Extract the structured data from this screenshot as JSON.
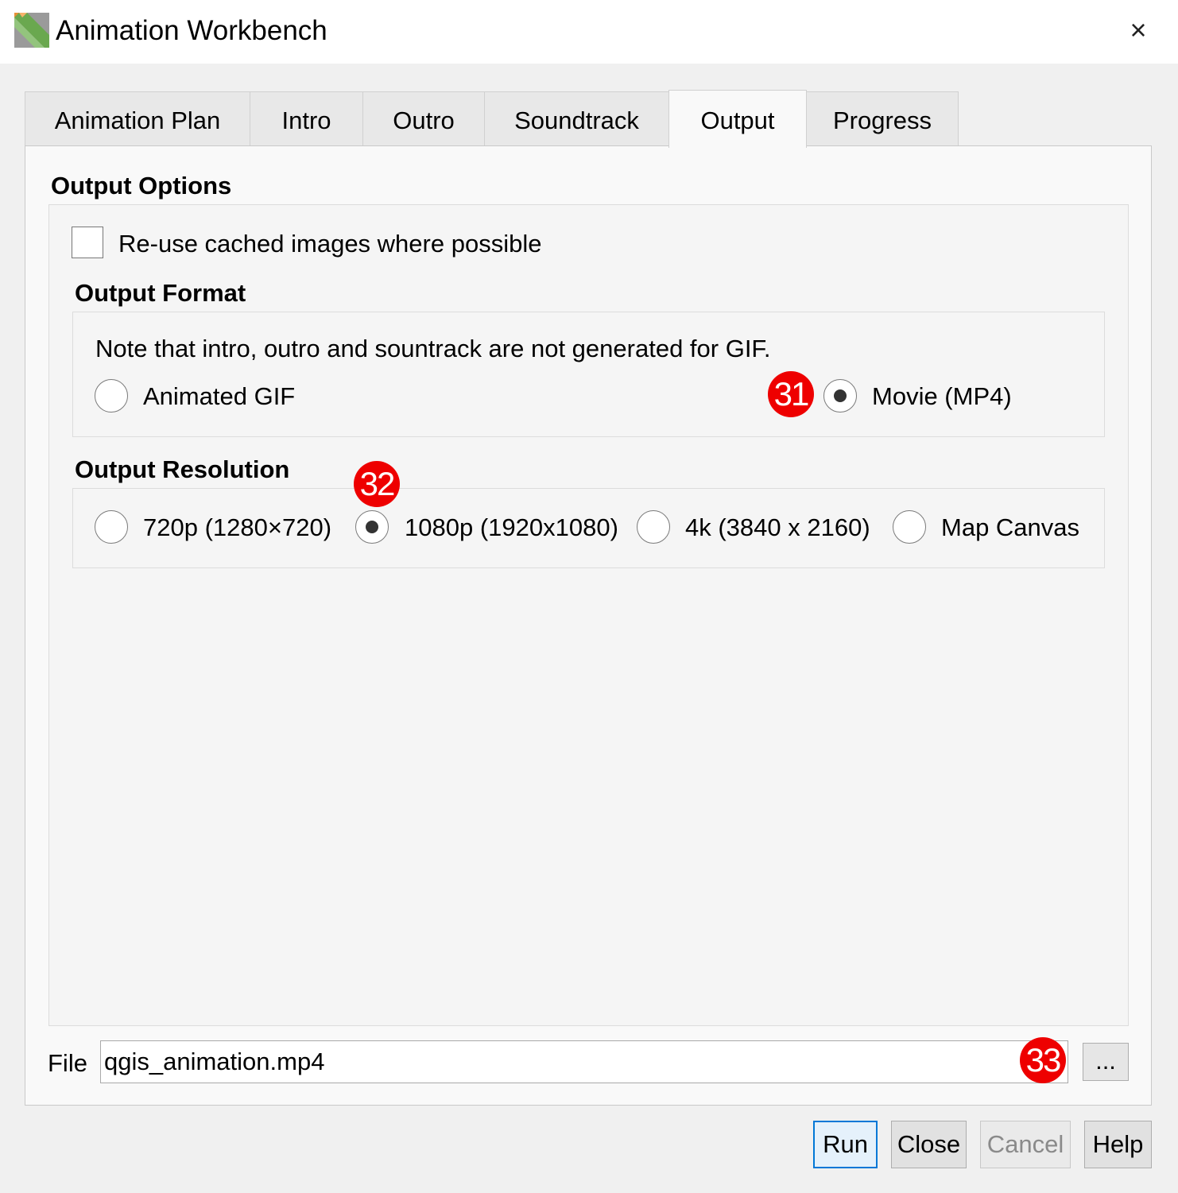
{
  "window": {
    "title": "Animation Workbench",
    "close_icon": "×"
  },
  "tabs": [
    {
      "label": "Animation Plan"
    },
    {
      "label": "Intro"
    },
    {
      "label": "Outro"
    },
    {
      "label": "Soundtrack"
    },
    {
      "label": "Output",
      "active": true
    },
    {
      "label": "Progress"
    }
  ],
  "output_options": {
    "title": "Output Options",
    "reuse_cache": {
      "label": "Re-use cached images where possible",
      "checked": false
    }
  },
  "output_format": {
    "title": "Output Format",
    "note": "Note that intro, outro and sountrack are not generated for GIF.",
    "options": [
      {
        "label": "Animated GIF",
        "checked": false
      },
      {
        "label": "Movie (MP4)",
        "checked": true
      }
    ]
  },
  "output_resolution": {
    "title": "Output Resolution",
    "options": [
      {
        "label": "720p (1280×720)",
        "checked": false
      },
      {
        "label": "1080p (1920x1080)",
        "checked": true
      },
      {
        "label": "4k (3840 x 2160)",
        "checked": false
      },
      {
        "label": "Map Canvas",
        "checked": false
      }
    ]
  },
  "file": {
    "label": "File",
    "value": "qgis_animation.mp4",
    "browse_label": "..."
  },
  "annotations": [
    "31",
    "32",
    "33"
  ],
  "buttons": {
    "run": "Run",
    "close": "Close",
    "cancel": "Cancel",
    "help": "Help"
  },
  "colors": {
    "badge": "#ee0000",
    "default_button_border": "#0078d7"
  }
}
